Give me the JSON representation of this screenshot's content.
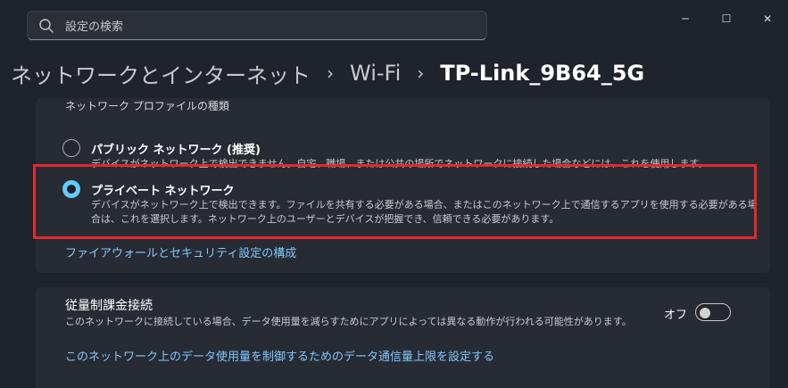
{
  "search": {
    "placeholder": "設定の検索"
  },
  "window": {
    "minimize": "─",
    "maximize": "☐",
    "close": "✕"
  },
  "breadcrumb": {
    "items": [
      "ネットワークとインターネット",
      "Wi-Fi",
      "TP-Link_9B64_5G"
    ],
    "separator": "›"
  },
  "profile": {
    "title": "ネットワーク プロファイルの種類",
    "options": [
      {
        "label": "パブリック ネットワーク (推奨)",
        "desc": "デバイスがネットワーク上で検出できません。自宅、職場、または公共の場所でネットワークに接続した場合などには、これを使用します。",
        "selected": false
      },
      {
        "label": "プライベート ネットワーク",
        "desc": "デバイスがネットワーク上で検出できます。ファイルを共有する必要がある場合、またはこのネットワーク上で通信するアプリを使用する必要がある場合は、これを選択します。ネットワーク上のユーザーとデバイスが把握でき、信頼できる必要があります。",
        "selected": true
      }
    ],
    "firewall_link": "ファイアウォールとセキュリティ設定の構成"
  },
  "metered": {
    "title": "従量制課金接続",
    "desc": "このネットワークに接続している場合、データ使用量を減らすためにアプリによっては異なる動作が行われる可能性があります。",
    "toggle_state": "オフ",
    "toggle_on": false,
    "limit_link": "このネットワーク上のデータ使用量を制御するためのデータ通信量上限を設定する"
  },
  "colors": {
    "accent": "#60cdff",
    "highlight": "#e5282c",
    "link": "#7fc8ff"
  }
}
